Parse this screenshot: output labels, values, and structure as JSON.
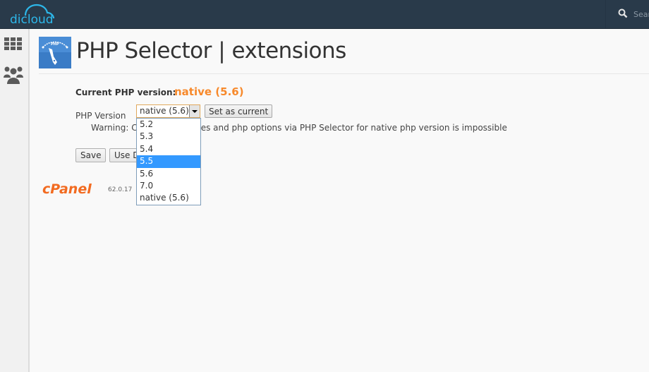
{
  "header": {
    "brand": "dicloud",
    "search_placeholder": "Search",
    "colors": {
      "bar": "#293a4a",
      "brand": "#2db6e8"
    }
  },
  "sidebar": {
    "items": [
      {
        "icon": "grid-icon",
        "label": "Home"
      },
      {
        "icon": "users-icon",
        "label": "Users"
      }
    ]
  },
  "page": {
    "title": "PHP Selector | extensions",
    "icon": "php-gauge-icon",
    "icon_text": "PHP"
  },
  "form": {
    "current_label": "Current PHP version:",
    "current_value": "native (5.6)",
    "version_label": "PHP Version",
    "select_value": "native (5.6)",
    "set_current_label": "Set as current",
    "warning": "Warning: Changing modules and php options via PHP Selector for native php version is impossible",
    "save_label": "Save",
    "use_default_label": "Use Defaults",
    "accent_color": "#f7892b"
  },
  "dropdown": {
    "options": [
      "5.2",
      "5.3",
      "5.4",
      "5.5",
      "5.6",
      "7.0",
      "native (5.6)"
    ],
    "highlighted": "5.5"
  },
  "footer": {
    "brand": "cPanel",
    "version": "62.0.17"
  }
}
